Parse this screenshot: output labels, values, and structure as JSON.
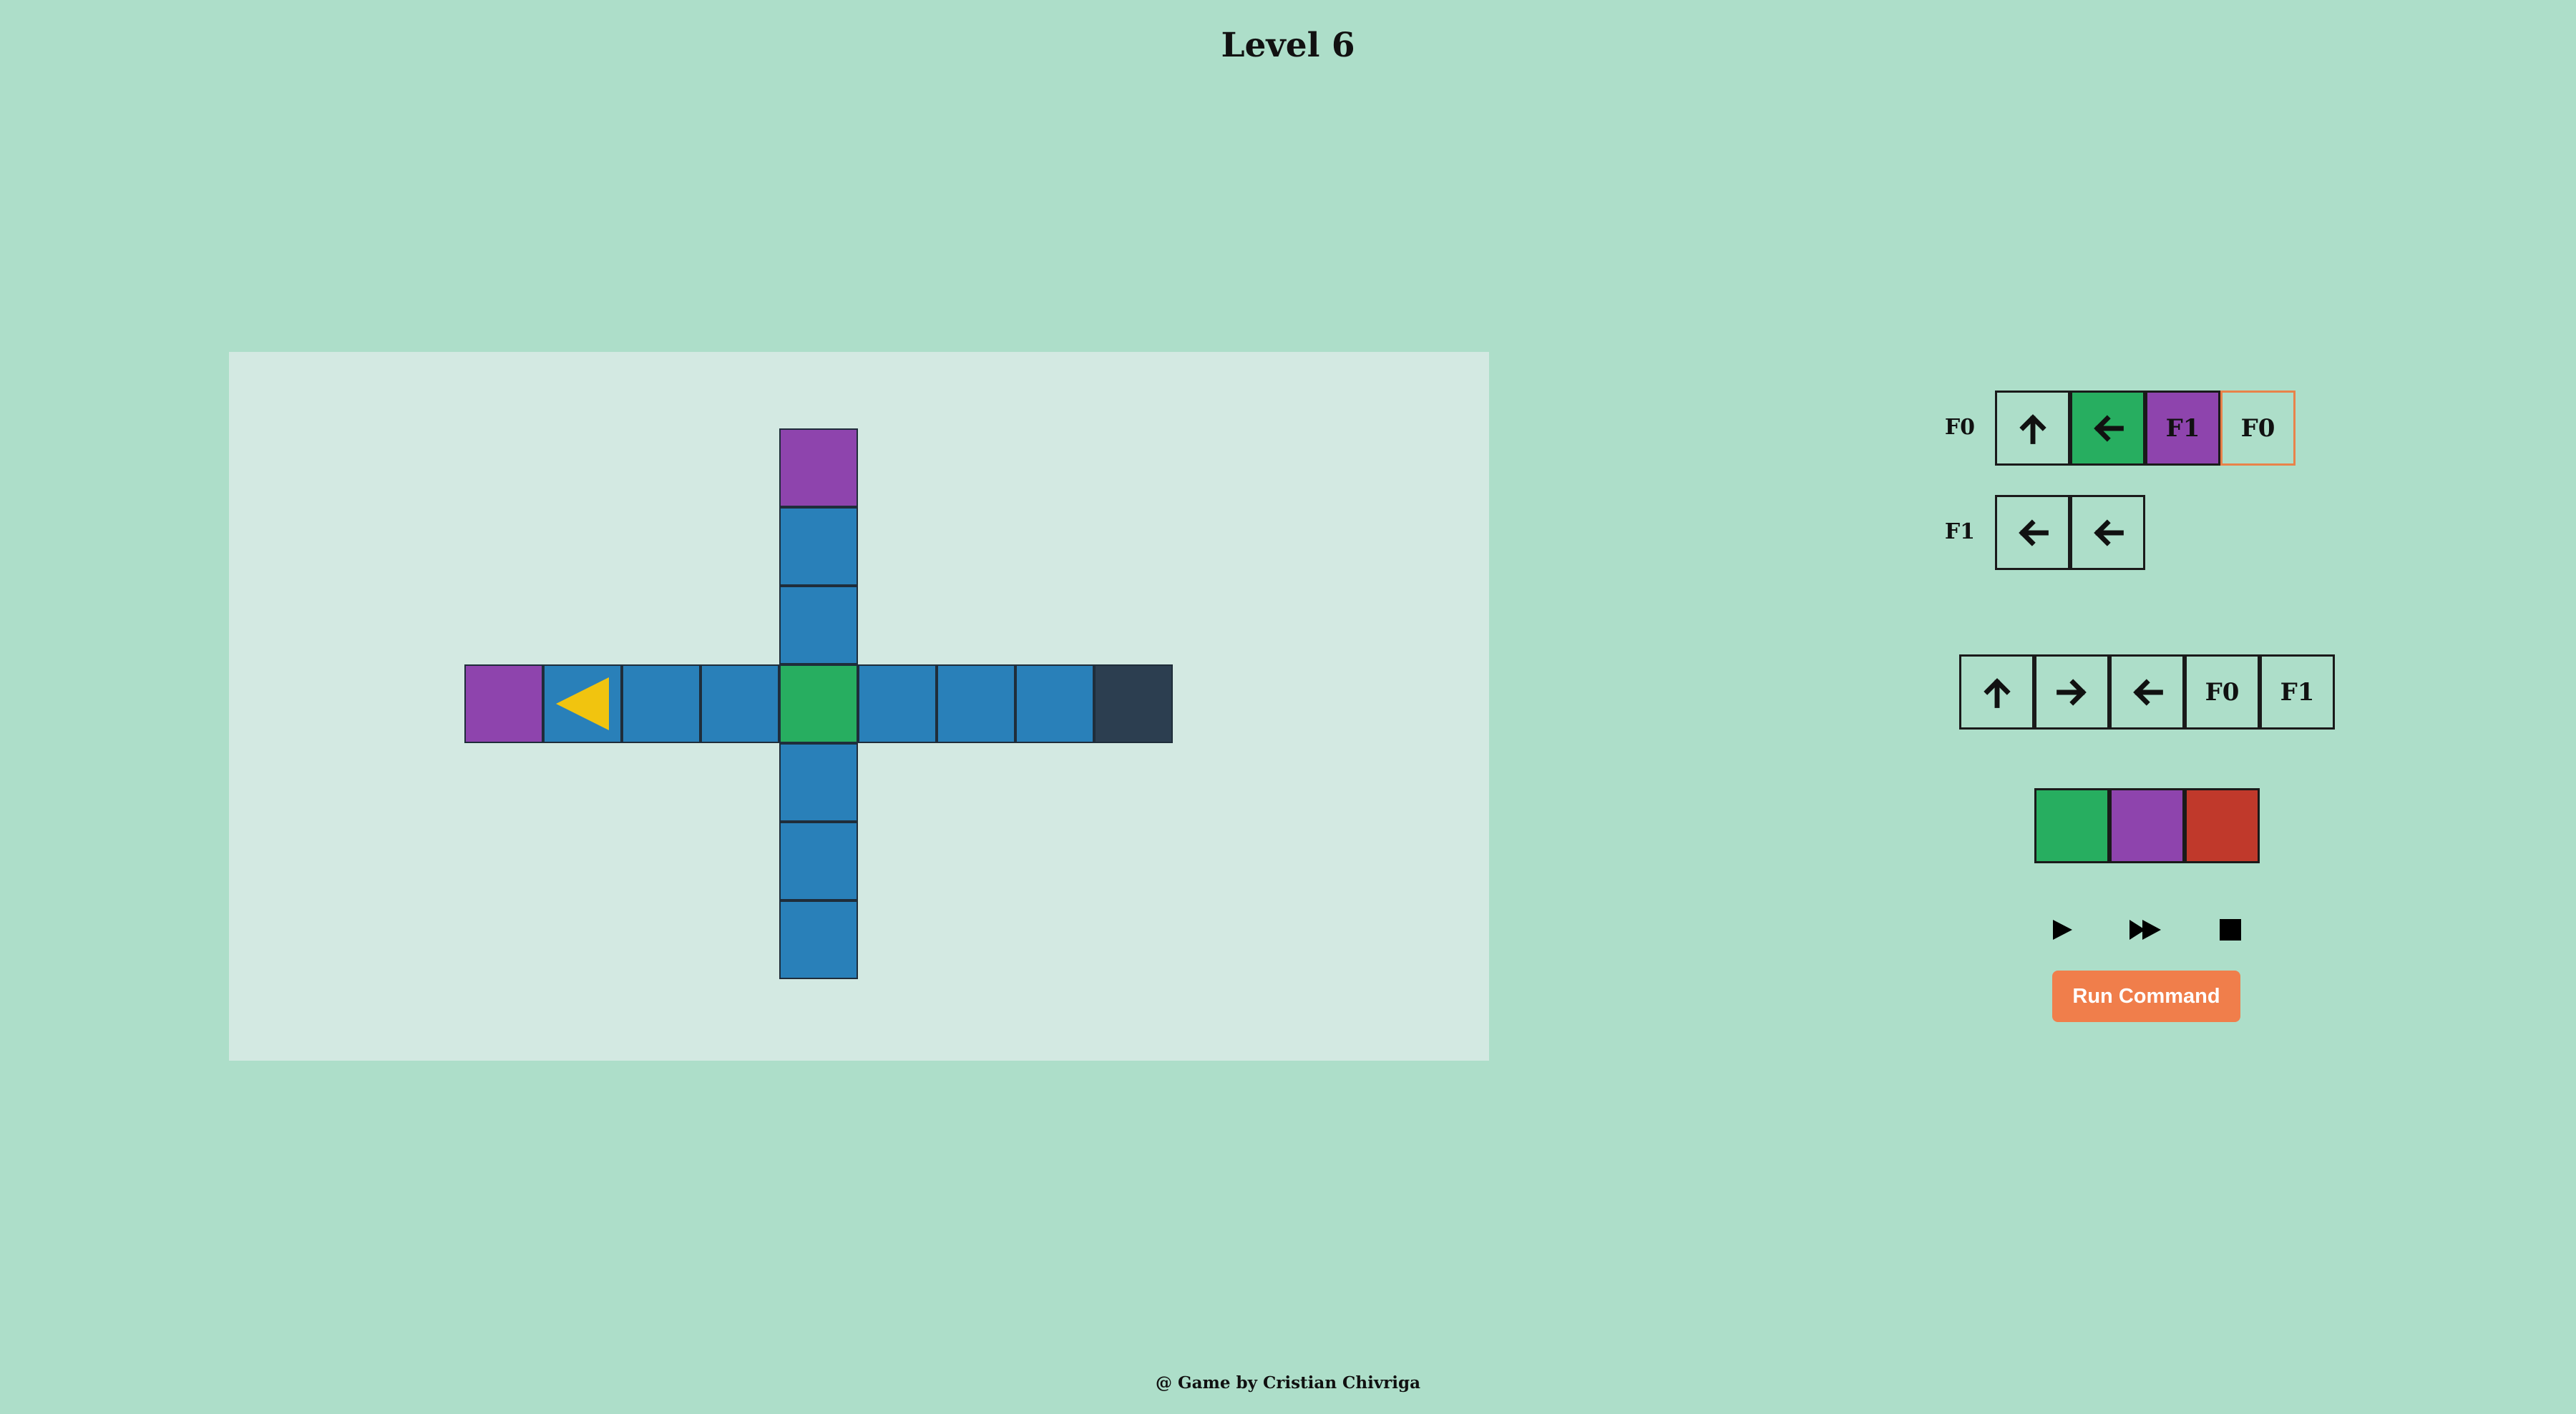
{
  "title": "Level 6",
  "footer": "@ Game by Cristian Chivriga",
  "colors": {
    "background": "#addec9",
    "board": "#d3e9e2",
    "blue": "#2980b9",
    "green": "#27ae60",
    "purple": "#8e44ad",
    "red": "#c0392b",
    "dark": "#2c3e50",
    "robot": "#f1c40f",
    "accent": "#f07e4b"
  },
  "board": {
    "robot": {
      "row": 3,
      "col": 1,
      "facing": "left",
      "icon": "robot-triangle-icon"
    },
    "tiles": [
      {
        "row": 0,
        "col": 4,
        "color": "purple"
      },
      {
        "row": 1,
        "col": 4,
        "color": "blue"
      },
      {
        "row": 2,
        "col": 4,
        "color": "blue"
      },
      {
        "row": 3,
        "col": 0,
        "color": "purple"
      },
      {
        "row": 3,
        "col": 1,
        "color": "blue"
      },
      {
        "row": 3,
        "col": 2,
        "color": "blue"
      },
      {
        "row": 3,
        "col": 3,
        "color": "blue"
      },
      {
        "row": 3,
        "col": 4,
        "color": "green"
      },
      {
        "row": 3,
        "col": 5,
        "color": "blue"
      },
      {
        "row": 3,
        "col": 6,
        "color": "blue"
      },
      {
        "row": 3,
        "col": 7,
        "color": "blue"
      },
      {
        "row": 3,
        "col": 8,
        "color": "dark"
      },
      {
        "row": 4,
        "col": 4,
        "color": "blue"
      },
      {
        "row": 5,
        "col": 4,
        "color": "blue"
      },
      {
        "row": 6,
        "col": 4,
        "color": "blue"
      }
    ]
  },
  "functions": [
    {
      "label": "F0",
      "slots": [
        {
          "type": "icon",
          "icon": "arrow-up-icon",
          "color": null,
          "selected": false
        },
        {
          "type": "icon",
          "icon": "arrow-left-icon",
          "color": "green",
          "selected": false
        },
        {
          "type": "text",
          "text": "F1",
          "color": "purple",
          "selected": false
        },
        {
          "type": "text",
          "text": "F0",
          "color": null,
          "selected": true
        }
      ]
    },
    {
      "label": "F1",
      "slots": [
        {
          "type": "icon",
          "icon": "arrow-left-icon",
          "color": null,
          "selected": false
        },
        {
          "type": "icon",
          "icon": "arrow-left-icon",
          "color": null,
          "selected": false
        }
      ]
    }
  ],
  "palette": {
    "commands": [
      {
        "type": "icon",
        "icon": "arrow-up-icon"
      },
      {
        "type": "icon",
        "icon": "arrow-right-icon"
      },
      {
        "type": "icon",
        "icon": "arrow-left-icon"
      },
      {
        "type": "text",
        "text": "F0"
      },
      {
        "type": "text",
        "text": "F1"
      }
    ],
    "colors": [
      "green",
      "purple",
      "red"
    ]
  },
  "playback": [
    {
      "name": "play",
      "icon": "play-icon"
    },
    {
      "name": "fast-forward",
      "icon": "fast-forward-icon"
    },
    {
      "name": "stop",
      "icon": "stop-icon"
    }
  ],
  "run_label": "Run Command"
}
